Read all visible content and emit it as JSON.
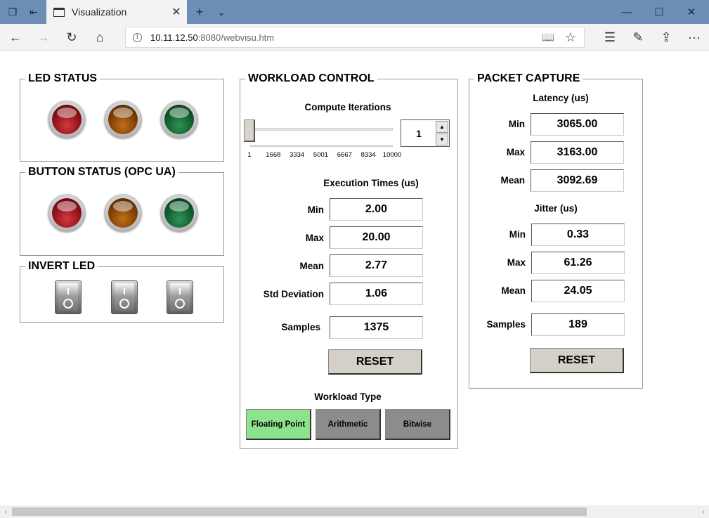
{
  "browser": {
    "tab_title": "Visualization",
    "tab_close": "✕",
    "new_tab": "+",
    "tab_dropdown": "⌄",
    "url_host": "10.11.12.50",
    "url_rest": ":8080/webvisu.htm",
    "info": "i",
    "window": {
      "minimize": "—",
      "maximize": "☐",
      "close": "✕"
    },
    "nav": {
      "back": "←",
      "forward": "→",
      "refresh": "↻",
      "home": "⌂"
    },
    "toolbar": {
      "reading": "📖",
      "favorite": "☆",
      "favorites_hub": "☰",
      "notes": "✎",
      "share": "⇪",
      "more": "···"
    }
  },
  "led_status": {
    "title": "LED STATUS",
    "leds": [
      {
        "color": "red"
      },
      {
        "color": "amber"
      },
      {
        "color": "green"
      }
    ]
  },
  "button_status": {
    "title": "BUTTON STATUS (OPC UA)",
    "leds": [
      {
        "color": "red"
      },
      {
        "color": "amber"
      },
      {
        "color": "green"
      }
    ]
  },
  "invert_led": {
    "title": "INVERT LED",
    "switch_count": 3
  },
  "workload_control": {
    "title": "WORKLOAD CONTROL",
    "compute_iterations_label": "Compute Iterations",
    "slider": {
      "min": 1,
      "max": 10000,
      "value": 1,
      "ticks": [
        "1",
        "1668",
        "3334",
        "5001",
        "6667",
        "8334",
        "10000"
      ]
    },
    "spin_value": "1",
    "spin_up": "▲",
    "spin_down": "▼",
    "execution_times_label": "Execution Times (us)",
    "rows": [
      {
        "label": "Min",
        "value": "2.00"
      },
      {
        "label": "Max",
        "value": "20.00"
      },
      {
        "label": "Mean",
        "value": "2.77"
      },
      {
        "label": "Std Deviation",
        "value": "1.06"
      }
    ],
    "samples_label": "Samples",
    "samples_value": "1375",
    "reset_label": "RESET",
    "workload_type_label": "Workload Type",
    "workload_types": [
      {
        "label": "Floating Point",
        "active": true,
        "color": "#8de38d"
      },
      {
        "label": "Arithmetic",
        "active": false,
        "color": "#8c8c8c"
      },
      {
        "label": "Bitwise",
        "active": false,
        "color": "#8c8c8c"
      }
    ]
  },
  "packet_capture": {
    "title": "PACKET CAPTURE",
    "latency_label": "Latency (us)",
    "latency": [
      {
        "label": "Min",
        "value": "3065.00"
      },
      {
        "label": "Max",
        "value": "3163.00"
      },
      {
        "label": "Mean",
        "value": "3092.69"
      }
    ],
    "jitter_label": "Jitter (us)",
    "jitter": [
      {
        "label": "Min",
        "value": "0.33"
      },
      {
        "label": "Max",
        "value": "61.26"
      },
      {
        "label": "Mean",
        "value": "24.05"
      }
    ],
    "samples_label": "Samples",
    "samples_value": "189",
    "reset_label": "RESET"
  },
  "scrollbar": {
    "left_arrow": "‹",
    "right_arrow": "›"
  }
}
